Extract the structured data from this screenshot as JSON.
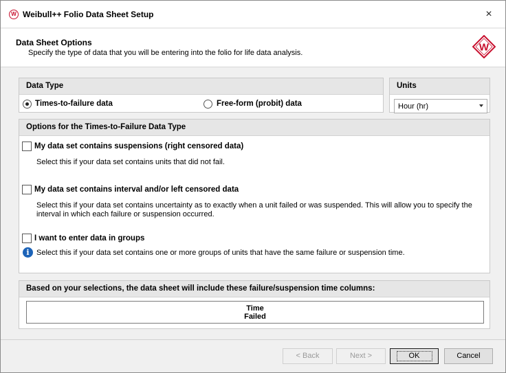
{
  "window": {
    "title": "Weibull++ Folio Data Sheet Setup",
    "logo_letter": "W",
    "close_glyph": "×"
  },
  "header": {
    "title": "Data Sheet Options",
    "subtitle": "Specify the type of data that you will be entering into the folio for life data analysis."
  },
  "data_type": {
    "heading": "Data Type",
    "options": [
      {
        "label": "Times-to-failure data",
        "selected": true
      },
      {
        "label": "Free-form (probit) data",
        "selected": false
      }
    ]
  },
  "units": {
    "heading": "Units",
    "selected": "Hour (hr)"
  },
  "options_panel": {
    "heading": "Options for the Times-to-Failure Data Type",
    "items": [
      {
        "label": "My data set contains suspensions (right censored data)",
        "checked": false,
        "description": "Select this if your data set contains units that did not fail."
      },
      {
        "label": "My data set contains interval and/or left censored data",
        "checked": false,
        "description_line1": "Select this if your data set contains uncertainty as to exactly when a unit failed or was suspended. This will allow you to specify the",
        "description_line2": "interval in which each failure or suspension occurred."
      },
      {
        "label": "I want to enter data in groups",
        "checked": false,
        "description": "Select this if your data set contains one or more groups of units that have the same failure or suspension time."
      }
    ]
  },
  "columns_panel": {
    "heading": "Based on your selections, the data sheet will include these failure/suspension time columns:",
    "columns": [
      "Time",
      "Failed"
    ]
  },
  "buttons": {
    "back": "< Back",
    "next": "Next >",
    "ok": "OK",
    "cancel": "Cancel"
  },
  "colors": {
    "brand": "#c8102e",
    "info": "#1c63b8"
  }
}
